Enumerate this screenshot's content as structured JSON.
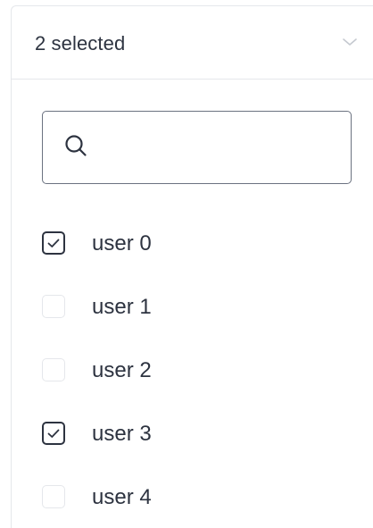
{
  "select": {
    "value": "2 selected",
    "chevron_icon": "chevron-down-icon"
  },
  "search": {
    "value": "",
    "placeholder": "",
    "icon": "search-icon"
  },
  "options": [
    {
      "label": "user 0",
      "checked": true
    },
    {
      "label": "user 1",
      "checked": false
    },
    {
      "label": "user 2",
      "checked": false
    },
    {
      "label": "user 3",
      "checked": true
    },
    {
      "label": "user 4",
      "checked": false
    }
  ],
  "colors": {
    "text": "#2d3340",
    "border": "#e5e7eb",
    "search_border": "#6b7280"
  }
}
